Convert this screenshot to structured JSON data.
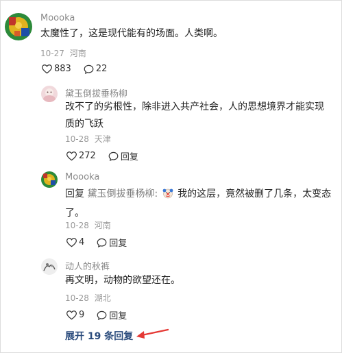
{
  "comments": [
    {
      "username": "Moooka",
      "content": "太魔性了，这是现代能有的场面。人类啊。",
      "date": "10-27",
      "location": "河南",
      "likes": "883",
      "replies": "22"
    }
  ],
  "replies": [
    {
      "username": "黛玉倒拔垂杨柳",
      "content_line1": "改不了的劣根性，除非进入共产社会，人的思想境界才能实现",
      "content_line2": "质的飞跃",
      "date": "10-28",
      "location": "天津",
      "likes": "272",
      "reply_label": "回复"
    },
    {
      "username": "Moooka",
      "reply_prefix": "回复",
      "reply_target": "黛玉倒拔垂杨柳:",
      "content_line1": "我的这层，竟然被删了几条，太变态",
      "content_line2": "了。",
      "date": "10-28",
      "location": "河南",
      "likes": "4",
      "reply_label": "回复"
    },
    {
      "username": "动人的秋裤",
      "content_line1": "再文明，动物的欲望还在。",
      "date": "10-28",
      "location": "湖北",
      "likes": "9",
      "reply_label": "回复"
    }
  ],
  "expand_label": "展开 19 条回复",
  "icons": {
    "like": "heart-outline-icon",
    "comment": "speech-bubble-icon",
    "emoji": "clown-face-icon",
    "annotation": "red-arrow"
  },
  "colors": {
    "expand_link": "#2a4b7c",
    "annotation_arrow": "#e53935"
  }
}
